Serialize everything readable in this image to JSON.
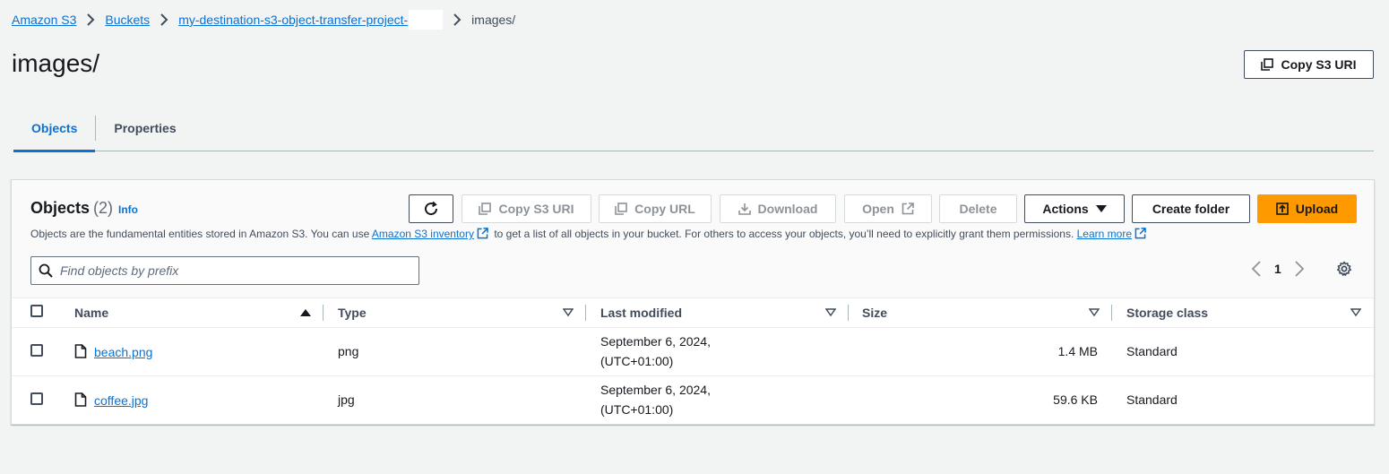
{
  "breadcrumb": {
    "items": [
      "Amazon S3",
      "Buckets",
      "my-destination-s3-object-transfer-project-"
    ],
    "current": "images/"
  },
  "page": {
    "title": "images/",
    "copy_uri_label": "Copy S3 URI"
  },
  "tabs": [
    {
      "label": "Objects",
      "active": true
    },
    {
      "label": "Properties",
      "active": false
    }
  ],
  "objects_panel": {
    "title": "Objects",
    "count": "(2)",
    "info": "Info",
    "desc_part1": "Objects are the fundamental entities stored in Amazon S3. You can use ",
    "inventory_link": "Amazon S3 inventory",
    "desc_part2": " to get a list of all objects in your bucket. For others to access your objects, you’ll need to explicitly grant them permissions. ",
    "learn_more": "Learn more",
    "search_placeholder": "Find objects by prefix",
    "page_number": "1",
    "buttons": {
      "copy_s3_uri": "Copy S3 URI",
      "copy_url": "Copy URL",
      "download": "Download",
      "open": "Open",
      "delete": "Delete",
      "actions": "Actions",
      "create_folder": "Create folder",
      "upload": "Upload"
    }
  },
  "table": {
    "columns": [
      "Name",
      "Type",
      "Last modified",
      "Size",
      "Storage class"
    ],
    "rows": [
      {
        "name": "beach.png",
        "type": "png",
        "modified_date": "September 6, 2024,",
        "modified_tz": "(UTC+01:00)",
        "size": "1.4 MB",
        "storage_class": "Standard"
      },
      {
        "name": "coffee.jpg",
        "type": "jpg",
        "modified_date": "September 6, 2024,",
        "modified_tz": "(UTC+01:00)",
        "size": "59.6 KB",
        "storage_class": "Standard"
      }
    ]
  },
  "colors": {
    "link": "#0972d3",
    "primary_button": "#ff9900",
    "background": "#f2f3f3"
  }
}
